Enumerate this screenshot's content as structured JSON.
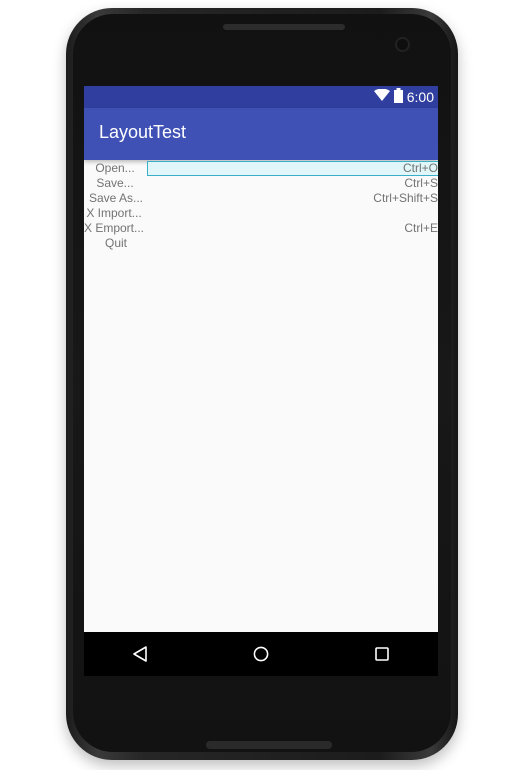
{
  "status_bar": {
    "time": "6:00",
    "icons": [
      "wifi-icon",
      "battery-icon"
    ]
  },
  "app_bar": {
    "title": "LayoutTest"
  },
  "menu": {
    "items": [
      {
        "label": "Open...",
        "shortcut": "Ctrl+O",
        "selected": true
      },
      {
        "label": "Save...",
        "shortcut": "Ctrl+S"
      },
      {
        "label": "Save As...",
        "shortcut": "Ctrl+Shift+S"
      },
      {
        "label": "X Import...",
        "shortcut": ""
      },
      {
        "label": "X Emport...",
        "shortcut": "Ctrl+E"
      },
      {
        "label": "Quit",
        "shortcut": ""
      }
    ]
  },
  "nav_bar": {
    "buttons": [
      "back-icon",
      "home-icon",
      "recents-icon"
    ]
  },
  "colors": {
    "status_bar": "#303f9f",
    "app_bar": "#3f51b5",
    "selection_fill": "#e0f6f8",
    "selection_border": "#3aaec8"
  }
}
